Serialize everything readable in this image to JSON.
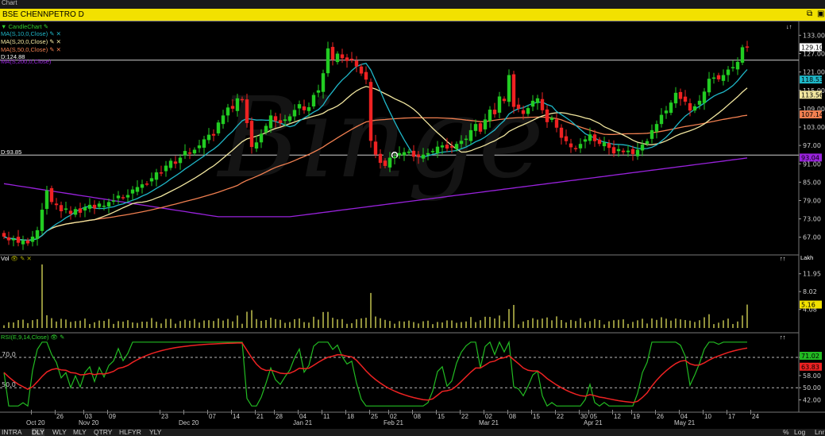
{
  "window": {
    "title": "Chart"
  },
  "header": {
    "symbol_title": "BSE CHENNPETRO D"
  },
  "legend": {
    "candle": "CandleChart",
    "ma10": "MA(S,10,0,Close)",
    "ma20": "MA(S,20,0,Close)",
    "ma50": "MA(S,50,0,Close)",
    "ma200": "MA(S,200,0,Close)",
    "vol": "Vol",
    "rsi": "RSI(E,9,14,Close)"
  },
  "levels": {
    "upper_line": "D:124.88",
    "lower_line": "D:93.85",
    "unit": "Lakh"
  },
  "colors": {
    "up": "#22cc22",
    "down": "#ee2222",
    "ma10": "#1fb7c8",
    "ma20": "#f2e7a0",
    "ma50": "#f07f50",
    "ma200": "#9922dd",
    "vol": "#b5b54a",
    "rsi_fast": "#22bb22",
    "rsi_slow": "#ee2222",
    "header_bg": "#f2e100"
  },
  "bottom_tabs": [
    "INTRA",
    "DLY",
    "WLY",
    "MLY",
    "QTRY",
    "HLFYR",
    "YLY"
  ],
  "bottom_active": "DLY",
  "bottom_right": [
    "%",
    "Log",
    "Lnr"
  ],
  "watermark": "Binge",
  "chart_data": [
    {
      "type": "candlestick",
      "title": "BSE CHENNPETRO D",
      "y_ticks": [
        133.0,
        127.0,
        121.0,
        115.0,
        109.0,
        103.0,
        97.0,
        91.0,
        85.0,
        79.0,
        73.0,
        67.0
      ],
      "ylim": [
        62.0,
        137.0
      ],
      "x_labels": [
        {
          "i": 6,
          "label": "Oct 20"
        },
        {
          "i": 11,
          "label": "26"
        },
        {
          "i": 17,
          "label": "03"
        },
        {
          "i": 17,
          "label": "Nov 20"
        },
        {
          "i": 22,
          "label": "09"
        },
        {
          "i": 33,
          "label": "23"
        },
        {
          "i": 38,
          "label": "Dec 20"
        },
        {
          "i": 43,
          "label": "07"
        },
        {
          "i": 48,
          "label": "14"
        },
        {
          "i": 53,
          "label": "21"
        },
        {
          "i": 57,
          "label": "28"
        },
        {
          "i": 62,
          "label": "04"
        },
        {
          "i": 62,
          "label": "Jan 21"
        },
        {
          "i": 67,
          "label": "11"
        },
        {
          "i": 72,
          "label": "18"
        },
        {
          "i": 77,
          "label": "25"
        },
        {
          "i": 81,
          "label": "02"
        },
        {
          "i": 81,
          "label": "Feb 21"
        },
        {
          "i": 86,
          "label": "08"
        },
        {
          "i": 91,
          "label": "15"
        },
        {
          "i": 96,
          "label": "22"
        },
        {
          "i": 101,
          "label": "02"
        },
        {
          "i": 101,
          "label": "Mar 21"
        },
        {
          "i": 106,
          "label": "08"
        },
        {
          "i": 111,
          "label": "15"
        },
        {
          "i": 116,
          "label": "22"
        },
        {
          "i": 121,
          "label": "30"
        },
        {
          "i": 123,
          "label": "05"
        },
        {
          "i": 123,
          "label": "Apr 21"
        },
        {
          "i": 128,
          "label": "12"
        },
        {
          "i": 132,
          "label": "19"
        },
        {
          "i": 137,
          "label": "26"
        },
        {
          "i": 142,
          "label": "04"
        },
        {
          "i": 142,
          "label": "May 21"
        },
        {
          "i": 147,
          "label": "10"
        },
        {
          "i": 152,
          "label": "17"
        },
        {
          "i": 157,
          "label": "24"
        }
      ],
      "ohlc_close": [
        67.2,
        66.0,
        66.4,
        65.2,
        66.0,
        65.0,
        67.2,
        69.3,
        76.0,
        82.3,
        78.5,
        77.5,
        75.5,
        76.4,
        74.6,
        76.2,
        75.0,
        76.8,
        77.6,
        76.4,
        78.0,
        77.3,
        78.5,
        79.0,
        80.6,
        80.0,
        80.8,
        82.6,
        83.4,
        84.3,
        84.5,
        86.3,
        88.2,
        88.1,
        90.4,
        92.0,
        91.0,
        93.0,
        95.2,
        94.4,
        95.6,
        97.0,
        99.0,
        100.5,
        100.2,
        104.5,
        106.8,
        109.4,
        109.0,
        112.4,
        111.8,
        104.3,
        96.5,
        98.0,
        100.8,
        103.4,
        106.8,
        105.0,
        104.3,
        105.5,
        106.5,
        108.6,
        110.5,
        108.5,
        109.5,
        113.5,
        115.0,
        120.6,
        128.7,
        125.0,
        127.0,
        125.5,
        124.6,
        125.2,
        122.8,
        120.5,
        118.5,
        98.5,
        94.0,
        91.3,
        90.3,
        93.0,
        93.3,
        94.5,
        94.8,
        95.0,
        93.3,
        93.2,
        94.0,
        94.5,
        95.2,
        96.6,
        97.0,
        96.0,
        96.3,
        97.5,
        98.5,
        99.2,
        102.0,
        104.0,
        101.5,
        105.5,
        108.7,
        107.2,
        113.0,
        111.5,
        120.0,
        109.6,
        109.0,
        107.3,
        109.2,
        111.6,
        112.4,
        108.5,
        104.6,
        106.0,
        102.8,
        99.5,
        98.4,
        96.4,
        95.8,
        97.5,
        99.0,
        100.6,
        98.4,
        97.5,
        98.0,
        96.2,
        94.4,
        95.8,
        94.8,
        95.3,
        94.2,
        95.6,
        97.3,
        98.4,
        102.0,
        104.0,
        107.0,
        108.4,
        111.0,
        114.2,
        112.2,
        111.3,
        108.4,
        109.8,
        111.6,
        114.6,
        118.8,
        119.2,
        118.6,
        120.0,
        121.8,
        122.6,
        124.3,
        129.1,
        129.1
      ],
      "ma_last": {
        "ma10": 118.53,
        "ma20": 113.56,
        "ma50": 107.14,
        "ma200": 93.04
      },
      "last_close": 129.1,
      "hlines": [
        124.88,
        93.85
      ]
    },
    {
      "type": "bar",
      "title": "Vol",
      "unit": "Lakh",
      "y_ticks": [
        11.95,
        8.02,
        4.08
      ],
      "ylim": [
        0,
        14.0
      ],
      "last": 5.16,
      "peak": 14.0
    },
    {
      "type": "line",
      "title": "RSI(E,9,14,Close)",
      "y_ticks": [
        70.0,
        58.0,
        50.0,
        42.0
      ],
      "ylim": [
        36,
        82
      ],
      "hlines": [
        70.0,
        50.0
      ],
      "last": {
        "fast": 71.02,
        "slow": 63.83
      }
    }
  ]
}
